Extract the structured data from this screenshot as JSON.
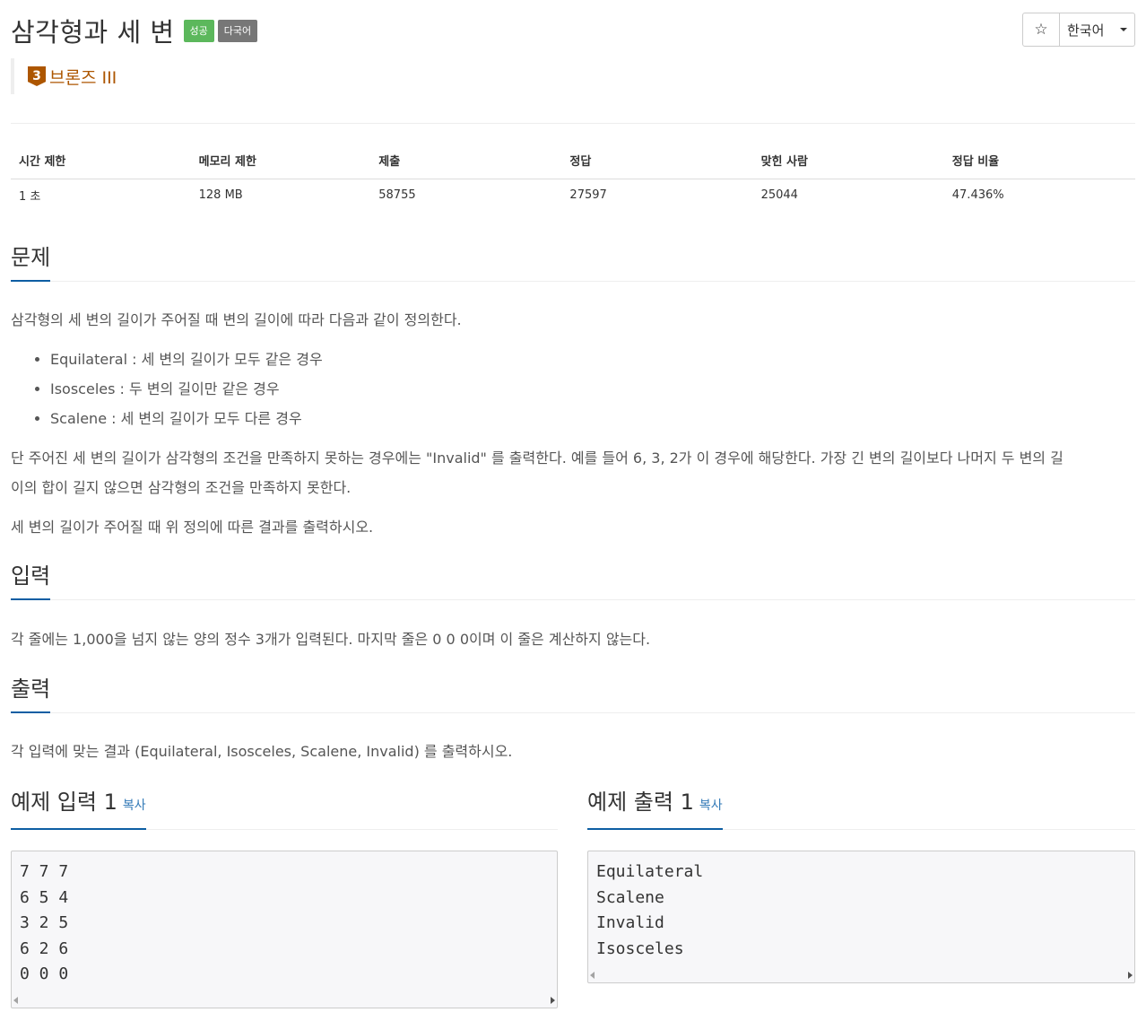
{
  "header": {
    "title": "삼각형과 세 변",
    "label_success": "성공",
    "label_multilang": "다국어",
    "star": "☆",
    "language": "한국어"
  },
  "tier": {
    "number": "3",
    "name": "브론즈 III"
  },
  "stats": {
    "headers": [
      "시간 제한",
      "메모리 제한",
      "제출",
      "정답",
      "맞힌 사람",
      "정답 비율"
    ],
    "values": [
      "1 초",
      "128 MB",
      "58755",
      "27597",
      "25044",
      "47.436%"
    ]
  },
  "problem": {
    "heading": "문제",
    "intro": "삼각형의 세 변의 길이가 주어질 때 변의 길이에 따라 다음과 같이 정의한다.",
    "items": [
      "Equilateral :  세 변의 길이가 모두 같은 경우",
      "Isosceles : 두 변의 길이만 같은 경우",
      "Scalene : 세 변의 길이가 모두 다른 경우"
    ],
    "para2_line1": "단 주어진 세 변의 길이가 삼각형의 조건을 만족하지 못하는 경우에는 \"Invalid\" 를 출력한다. 예를 들어 6, 3, 2가 이 경우에 해당한다. 가장 긴 변의 길이보다 나머지 두 변의 길",
    "para2_line2": "이의 합이 길지 않으면 삼각형의 조건을 만족하지 못한다.",
    "para3": "세 변의 길이가 주어질 때 위 정의에 따른 결과를 출력하시오."
  },
  "input_section": {
    "heading": "입력",
    "text": "각 줄에는 1,000을 넘지 않는 양의 정수 3개가 입력된다. 마지막 줄은 0 0 0이며 이 줄은 계산하지 않는다."
  },
  "output_section": {
    "heading": "출력",
    "text": "각 입력에 맞는 결과 (Equilateral, Isosceles, Scalene, Invalid) 를 출력하시오."
  },
  "sample_input": {
    "heading": "예제 입력 1",
    "copy": "복사",
    "content": "7 7 7\n6 5 4\n3 2 5\n6 2 6\n0 0 0"
  },
  "sample_output": {
    "heading": "예제 출력 1",
    "copy": "복사",
    "content": "Equilateral\nScalene\nInvalid\nIsosceles"
  },
  "colors": {
    "success": "#5cb85c",
    "multilang": "#777777",
    "bronze": "#ad5600",
    "heading_underline": "#0d5ea3",
    "link": "#337ab7"
  }
}
